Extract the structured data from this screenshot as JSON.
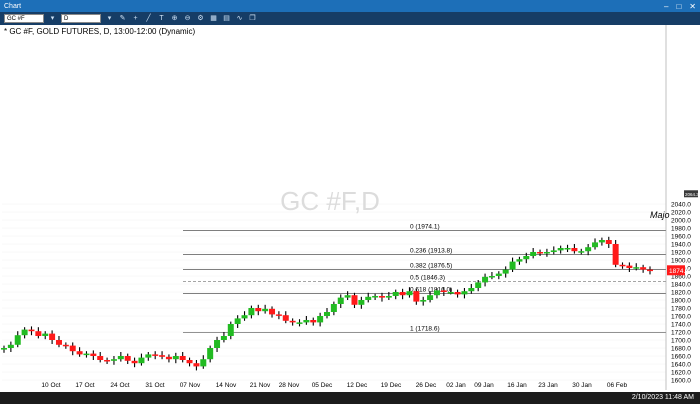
{
  "window": {
    "title": "Chart"
  },
  "toolbar": {
    "symbol": "GC #F",
    "period": "D"
  },
  "chart_header": "* GC #F, GOLD FUTURES, D, 13:00-12:00 (Dynamic)",
  "watermark": "GC #F,D",
  "right_annotation": "Majo",
  "status": {
    "datetime": "2/10/2023 11:48 AM"
  },
  "price_axis": {
    "labels": [
      "2040.0",
      "2020.0",
      "2000.0",
      "1980.0",
      "1960.0",
      "1940.0",
      "1920.0",
      "1900.0",
      "1880.0",
      "1860.0",
      "1840.0",
      "1820.0",
      "1800.0",
      "1780.0",
      "1760.0",
      "1740.0",
      "1720.0",
      "1700.0",
      "1680.0",
      "1660.0",
      "1640.0",
      "1620.0",
      "1600.0"
    ],
    "last_price": "1874.3",
    "top_badge": "2064.3"
  },
  "colors": {
    "up": "#22bb22",
    "down": "#ff1a1a",
    "wick": "#000000",
    "accent": "#1d6fb8"
  },
  "chart_data": {
    "type": "candlestick",
    "symbol": "GC #F",
    "title": "GC #F, GOLD FUTURES, D, 13:00-12:00 (Dynamic)",
    "x_tick_labels": [
      "10 Oct",
      "17 Oct",
      "24 Oct",
      "31 Oct",
      "07 Nov",
      "14 Nov",
      "21 Nov",
      "28 Nov",
      "05 Dec",
      "12 Dec",
      "19 Dec",
      "26 Dec",
      "02 Jan",
      "09 Jan",
      "16 Jan",
      "23 Jan",
      "30 Jan",
      "06 Feb"
    ],
    "y_range": [
      1600,
      2064
    ],
    "fib_levels": [
      {
        "label": "0 (1974.1)",
        "value": 1974.1
      },
      {
        "label": "0.236 (1913.8)",
        "value": 1913.8
      },
      {
        "label": "0.382 (1876.5)",
        "value": 1876.5
      },
      {
        "label": "0.5 (1846.3)",
        "value": 1846.3
      },
      {
        "label": "0.618 (1816.0)",
        "value": 1816.0
      },
      {
        "label": "1 (1718.6)",
        "value": 1718.6
      }
    ],
    "closes": [
      1680,
      1688,
      1712,
      1726,
      1722,
      1710,
      1716,
      1700,
      1688,
      1686,
      1672,
      1664,
      1666,
      1660,
      1650,
      1648,
      1652,
      1660,
      1648,
      1642,
      1656,
      1664,
      1662,
      1658,
      1652,
      1660,
      1650,
      1642,
      1634,
      1652,
      1680,
      1700,
      1710,
      1740,
      1754,
      1762,
      1780,
      1772,
      1778,
      1764,
      1762,
      1748,
      1744,
      1744,
      1750,
      1744,
      1760,
      1770,
      1790,
      1806,
      1812,
      1788,
      1800,
      1808,
      1810,
      1806,
      1810,
      1820,
      1812,
      1822,
      1796,
      1800,
      1812,
      1824,
      1820,
      1820,
      1814,
      1822,
      1830,
      1844,
      1858,
      1860,
      1866,
      1876,
      1896,
      1902,
      1910,
      1920,
      1918,
      1920,
      1924,
      1930,
      1930,
      1922,
      1922,
      1932,
      1944,
      1950,
      1940,
      1888,
      1886,
      1880,
      1882,
      1876,
      1874
    ]
  }
}
